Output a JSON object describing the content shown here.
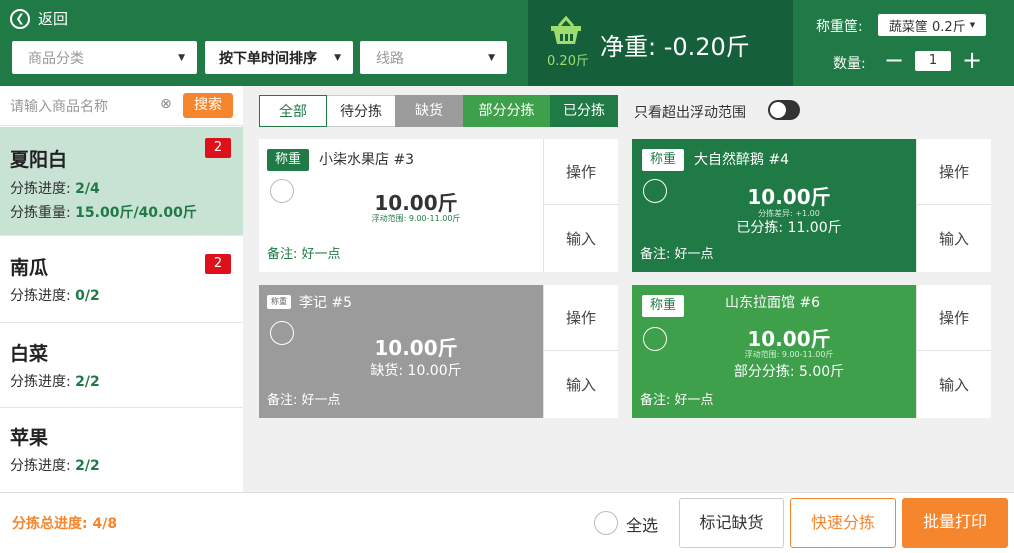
{
  "header": {
    "back_label": "返回",
    "category_placeholder": "商品分类",
    "sort_label": "按下单时间排序",
    "route_placeholder": "线路",
    "basket_weight": "0.20斤",
    "net_weight": "净重: -0.20斤",
    "basket_label": "称重筐:",
    "basket_value": "蔬菜筐 0.2斤",
    "qty_label": "数量:",
    "qty_value": "1",
    "minus": "−",
    "plus": "+"
  },
  "sidebar": {
    "search_placeholder": "请输入商品名称",
    "search_button": "搜索",
    "clear": "⊗",
    "items": [
      {
        "name": "夏阳白",
        "badge": "2",
        "progress_label": "分拣进度: ",
        "progress": "2/4",
        "weight_label": "分拣重量: ",
        "weight": "15.00斤/40.00斤"
      },
      {
        "name": "南瓜",
        "badge": "2",
        "progress_label": "分拣进度: ",
        "progress": "0/2"
      },
      {
        "name": "白菜",
        "progress_label": "分拣进度: ",
        "progress": "2/2"
      },
      {
        "name": "苹果",
        "progress_label": "分拣进度: ",
        "progress": "2/2"
      }
    ]
  },
  "filters": {
    "tabs": [
      "全部",
      "待分拣",
      "缺货",
      "部分分拣",
      "已分拣"
    ],
    "only_over_label": "只看超出浮动范围"
  },
  "cards": [
    {
      "tag": "称重",
      "name": "小柒水果店 #3",
      "weight": "10.00斤",
      "small": "浮动范围: 9.00-11.00斤",
      "line": "",
      "note": "备注: 好一点",
      "op": "操作",
      "input": "输入"
    },
    {
      "tag": "称重",
      "name": "大自然醉鹅 #4",
      "weight": "10.00斤",
      "small": "分拣差异: +1.00",
      "line": "已分拣: 11.00斤",
      "note": "备注: 好一点",
      "op": "操作",
      "input": "输入"
    },
    {
      "tag": "称重",
      "name": "李记 #5",
      "weight": "10.00斤",
      "small": "",
      "line": "缺货: 10.00斤",
      "note": "备注: 好一点",
      "op": "操作",
      "input": "输入"
    },
    {
      "tag": "称重",
      "name": "山东拉面馆 #6",
      "weight": "10.00斤",
      "small": "浮动范围: 9.00-11.00斤",
      "line": "部分分拣: 5.00斤",
      "note": "备注: 好一点",
      "op": "操作",
      "input": "输入"
    }
  ],
  "footer": {
    "total_label": "分拣总进度: 4/8",
    "select_all": "全选",
    "mark_out": "标记缺货",
    "quick_sort": "快速分拣",
    "batch_print": "批量打印"
  },
  "colors": {
    "primary": "#1f7a45",
    "accent": "#f5862e",
    "badge": "#e0101a",
    "out_of_stock": "#9b9b9b",
    "partial": "#3ea04a"
  }
}
